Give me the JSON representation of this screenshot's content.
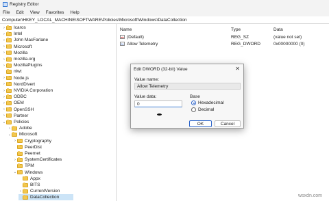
{
  "window": {
    "title": "Registry Editor",
    "icon": "registry-icon"
  },
  "menu": [
    "File",
    "Edit",
    "View",
    "Favorites",
    "Help"
  ],
  "address": "Computer\\HKEY_LOCAL_MACHINE\\SOFTWARE\\Policies\\Microsoft\\Windows\\DataCollection",
  "tree": [
    {
      "label": "Icaros",
      "level": 0,
      "expander": "›"
    },
    {
      "label": "Intel",
      "level": 0,
      "expander": "›"
    },
    {
      "label": "John MacFarlane",
      "level": 0,
      "expander": "›"
    },
    {
      "label": "Microsoft",
      "level": 0,
      "expander": "›"
    },
    {
      "label": "Mozilla",
      "level": 0,
      "expander": "›"
    },
    {
      "label": "mozilla.org",
      "level": 0,
      "expander": "›"
    },
    {
      "label": "MozillaPlugins",
      "level": 0,
      "expander": "›"
    },
    {
      "label": "nlwt",
      "level": 0,
      "expander": ""
    },
    {
      "label": "Node.js",
      "level": 0,
      "expander": "›"
    },
    {
      "label": "NordDivert",
      "level": 0,
      "expander": "›"
    },
    {
      "label": "NVIDIA Corporation",
      "level": 0,
      "expander": "›"
    },
    {
      "label": "ODBC",
      "level": 0,
      "expander": "›"
    },
    {
      "label": "OEM",
      "level": 0,
      "expander": "›"
    },
    {
      "label": "OpenSSH",
      "level": 0,
      "expander": "›"
    },
    {
      "label": "Partner",
      "level": 0,
      "expander": "›"
    },
    {
      "label": "Policies",
      "level": 0,
      "expander": "⌄"
    },
    {
      "label": "Adobe",
      "level": 1,
      "expander": "›"
    },
    {
      "label": "Microsoft",
      "level": 1,
      "expander": "⌄"
    },
    {
      "label": "Cryptography",
      "level": 2,
      "expander": "›"
    },
    {
      "label": "PeerDist",
      "level": 2,
      "expander": ""
    },
    {
      "label": "Peernet",
      "level": 2,
      "expander": ""
    },
    {
      "label": "SystemCertificates",
      "level": 2,
      "expander": "›"
    },
    {
      "label": "TPM",
      "level": 2,
      "expander": ""
    },
    {
      "label": "Windows",
      "level": 2,
      "expander": "⌄"
    },
    {
      "label": "Appx",
      "level": 3,
      "expander": ""
    },
    {
      "label": "BITS",
      "level": 3,
      "expander": ""
    },
    {
      "label": "CurrentVersion",
      "level": 3,
      "expander": "›"
    },
    {
      "label": "DataCollection",
      "level": 3,
      "expander": "",
      "selected": true
    }
  ],
  "list": {
    "headers": {
      "name": "Name",
      "type": "Type",
      "data": "Data"
    },
    "rows": [
      {
        "name": "(Default)",
        "type": "REG_SZ",
        "data": "(value not set)",
        "icon": "string-value-icon",
        "glyph": "ab"
      },
      {
        "name": "Allow Telemetry",
        "type": "REG_DWORD",
        "data": "0x00000000 (0)",
        "icon": "binary-value-icon",
        "glyph": "01"
      }
    ]
  },
  "dialog": {
    "title": "Edit DWORD (32-bit) Value",
    "close": "✕",
    "value_name_label": "Value name:",
    "value_name": "Allow Telemetry",
    "value_data_label": "Value data:",
    "value_data": "0",
    "base_label": "Base",
    "base_options": [
      {
        "label": "Hexadecimal",
        "selected": true
      },
      {
        "label": "Decimal",
        "selected": false
      }
    ],
    "ok_label": "OK",
    "cancel_label": "Cancel"
  },
  "watermark": "wsxdn.com",
  "colors": {
    "selection": "#cce4f7",
    "accent": "#2a62c9",
    "folder": "#f3c74e"
  }
}
